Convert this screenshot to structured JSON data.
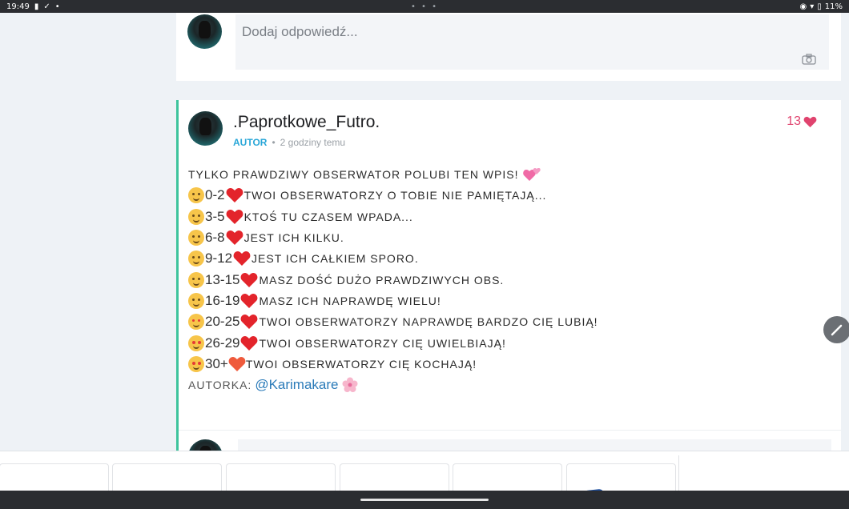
{
  "status": {
    "time": "19:49",
    "dots": "• • •",
    "battery": "11%"
  },
  "reply": {
    "placeholder": "Dodaj odpowiedź..."
  },
  "post": {
    "username": ".Paprotkowe_Futro.",
    "badge": "AUTOR",
    "separator": "•",
    "time": "2 godziny temu",
    "likes": "13",
    "lines": [
      {
        "range": "",
        "text": "Tylko prawdziwy obserwator polubi ten wpis!"
      },
      {
        "range": "0-2 ",
        "text": "Twoi obserwatorzy o tobie nie pamiętają..."
      },
      {
        "range": "3-5",
        "text": "Ktoś tu czasem wpada..."
      },
      {
        "range": "6-8",
        "text": "Jest ich kilku."
      },
      {
        "range": "9-12",
        "text": " Jest ich całkiem sporo."
      },
      {
        "range": "13-15",
        "text": "Masz dość dużo prawdziwych obs."
      },
      {
        "range": "16-19",
        "text": "Masz ich naprawdę wielu!"
      },
      {
        "range": "20-25",
        "text": "Twoi obserwatorzy naprawdę bardzo cię lubią!"
      },
      {
        "range": "26-29",
        "text": " Twoi obserwatorzy cię uwielbiają!"
      },
      {
        "range": "30+",
        "text": " Twoi obserwatorzy cię kochają!"
      }
    ],
    "author_label": "Autorka:",
    "mention": "@Karimakare"
  },
  "colors": {
    "accent_green": "#3ec49d",
    "like_pink": "#e0436e",
    "author_blue": "#2aa7d8",
    "mention_blue": "#2b7bb9"
  }
}
